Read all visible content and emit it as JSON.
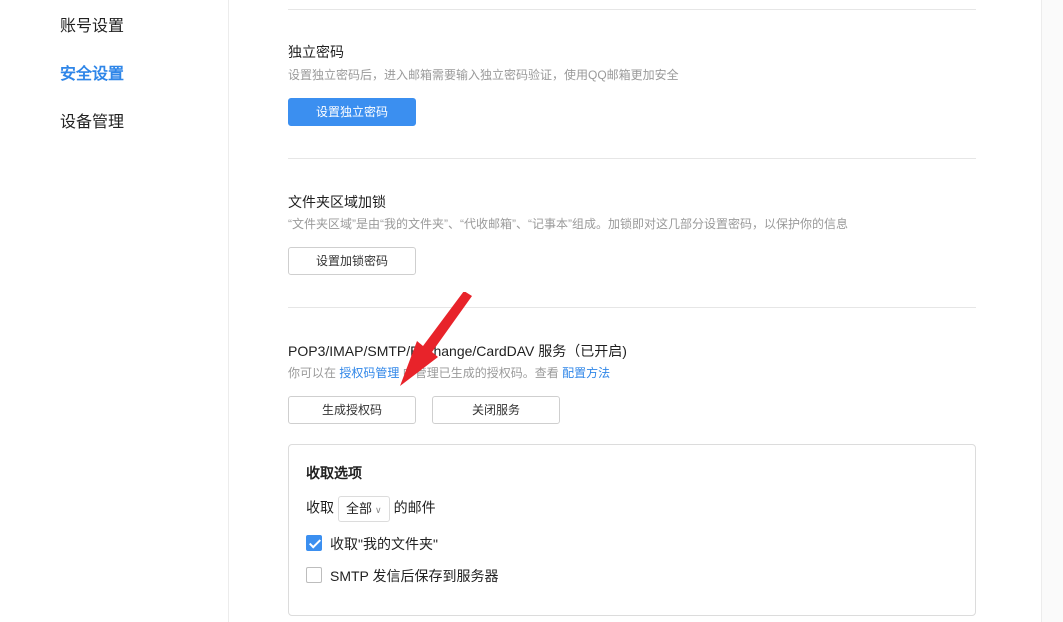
{
  "sidebar": {
    "items": [
      {
        "label": "账号设置"
      },
      {
        "label": "安全设置"
      },
      {
        "label": "设备管理"
      }
    ]
  },
  "sections": {
    "independent_password": {
      "title": "独立密码",
      "desc": "设置独立密码后，进入邮箱需要输入独立密码验证，使用QQ邮箱更加安全",
      "button": "设置独立密码"
    },
    "folder_lock": {
      "title": "文件夹区域加锁",
      "desc": "“文件夹区域”是由“我的文件夹”、“代收邮箱”、“记事本”组成。加锁即对这几部分设置密码，以保护你的信息",
      "button": "设置加锁密码"
    },
    "pop3": {
      "title": "POP3/IMAP/SMTP/Exchange/CardDAV 服务（已开启)",
      "desc_prefix": "你可以在",
      "link_auth": "授权码管理",
      "desc_mid": "中管理已生成的授权码。查看",
      "link_config": "配置方法",
      "button_generate": "生成授权码",
      "button_close": "关闭服务"
    }
  },
  "options": {
    "title": "收取选项",
    "receive_prefix": "收取",
    "receive_select": "全部",
    "receive_suffix": "的邮件",
    "checkbox_my_folders": {
      "label": "收取\"我的文件夹\"",
      "checked": true
    },
    "checkbox_smtp_save": {
      "label": "SMTP 发信后保存到服务器",
      "checked": false
    }
  },
  "colors": {
    "accent": "#3b8ff0",
    "annotation_arrow": "#e8232a"
  }
}
